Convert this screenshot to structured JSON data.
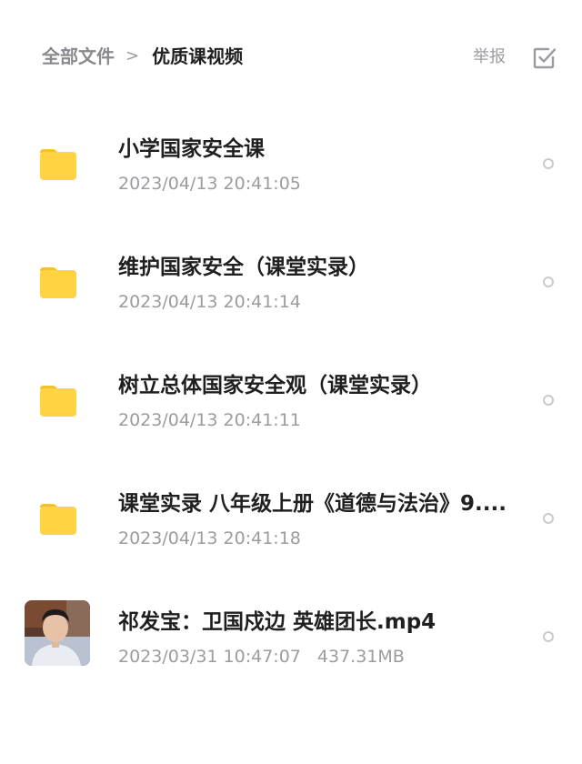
{
  "header": {
    "breadcrumb_root": "全部文件",
    "breadcrumb_separator": ">",
    "breadcrumb_current": "优质课视频",
    "report_label": "举报"
  },
  "files": [
    {
      "name": "小学国家安全课",
      "date": "2023/04/13 20:41:05",
      "type": "folder"
    },
    {
      "name": "维护国家安全（课堂实录）",
      "date": "2023/04/13 20:41:14",
      "type": "folder"
    },
    {
      "name": "树立总体国家安全观（课堂实录）",
      "date": "2023/04/13 20:41:11",
      "type": "folder"
    },
    {
      "name": "课堂实录 八年级上册《道德与法治》9....",
      "date": "2023/04/13 20:41:18",
      "type": "folder"
    },
    {
      "name": "祁发宝：卫国戍边 英雄团长.mp4",
      "date": "2023/03/31 10:47:07",
      "size": "437.31MB",
      "type": "video"
    }
  ],
  "colors": {
    "folder": "#FFD341",
    "folder_tab": "#F5C02A",
    "muted_text": "#9a9ca1"
  },
  "icons": {
    "folder": "folder-icon",
    "select": "checkbox-select-icon",
    "radio": "radio-unselected-icon"
  }
}
